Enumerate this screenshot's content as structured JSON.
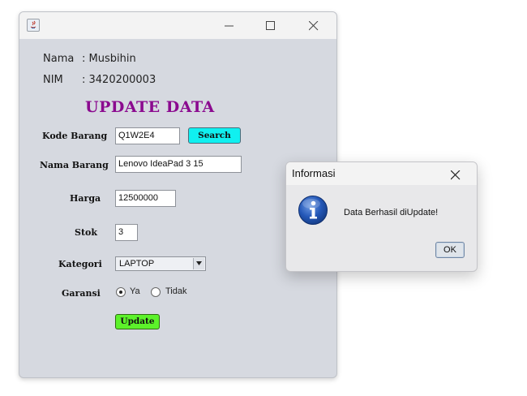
{
  "window": {
    "name_label": "Nama",
    "name_value": ": Musbihin",
    "nim_label": "NIM",
    "nim_value": ": 3420200003",
    "heading": "UPDATE DATA"
  },
  "form": {
    "kode_label": "Kode Barang",
    "kode_value": "Q1W2E4",
    "search_label": "Search",
    "nama_label": "Nama Barang",
    "nama_value": "Lenovo IdeaPad 3 15",
    "harga_label": "Harga",
    "harga_value": "12500000",
    "stok_label": "Stok",
    "stok_value": "3",
    "kategori_label": "Kategori",
    "kategori_value": "LAPTOP",
    "garansi_label": "Garansi",
    "garansi_options": [
      "Ya",
      "Tidak"
    ],
    "garansi_selected": "Ya",
    "update_label": "Update"
  },
  "dialog": {
    "title": "Informasi",
    "message": "Data Berhasil diUpdate!",
    "ok_label": "OK",
    "icon": "info-icon"
  },
  "colors": {
    "heading": "#8b0a8f",
    "search_button": "#10f0f0",
    "update_button": "#5cf22a",
    "window_bg": "#d6d9e0"
  }
}
